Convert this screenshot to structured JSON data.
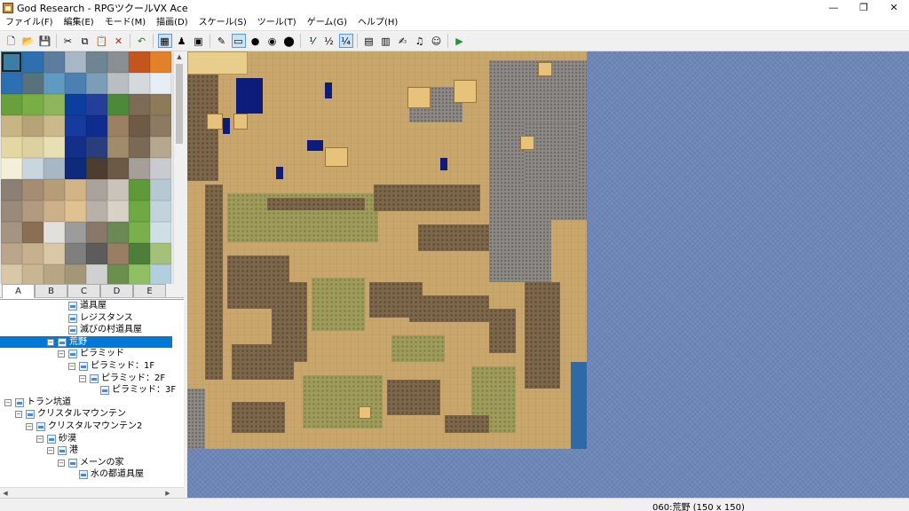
{
  "window": {
    "title": "God Research - RPGツクールVX Ace",
    "controls": {
      "minimize": "—",
      "restore": "❐",
      "close": "✕"
    }
  },
  "menu": [
    "ファイル(F)",
    "編集(E)",
    "モード(M)",
    "描画(D)",
    "スケール(S)",
    "ツール(T)",
    "ゲーム(G)",
    "ヘルプ(H)"
  ],
  "toolbar": {
    "icons": [
      "new-project-icon",
      "open-project-icon",
      "save-project-icon",
      "sep",
      "cut-icon",
      "copy-icon",
      "paste-icon",
      "delete-icon",
      "sep",
      "undo-icon",
      "sep",
      "map-mode-icon",
      "event-mode-icon",
      "region-mode-icon",
      "sep",
      "pencil-icon",
      "rectangle-icon",
      "ellipse-icon",
      "fill-icon",
      "shadow-pen-icon",
      "sep",
      "zoom-1-1-icon",
      "zoom-1-2-icon",
      "zoom-1-4-icon",
      "sep",
      "database-icon",
      "resource-manager-icon",
      "script-editor-icon",
      "sound-test-icon",
      "character-generator-icon",
      "sep",
      "playtest-icon"
    ],
    "glyphs": {
      "new-project-icon": "🗋",
      "open-project-icon": "📂",
      "save-project-icon": "💾",
      "cut-icon": "✂",
      "copy-icon": "⧉",
      "paste-icon": "📋",
      "delete-icon": "✕",
      "undo-icon": "↶",
      "map-mode-icon": "▦",
      "event-mode-icon": "♟",
      "region-mode-icon": "▣",
      "pencil-icon": "✎",
      "rectangle-icon": "▭",
      "ellipse-icon": "●",
      "fill-icon": "◉",
      "shadow-pen-icon": "⬤",
      "zoom-1-1-icon": "⅟",
      "zoom-1-2-icon": "½",
      "zoom-1-4-icon": "¼",
      "database-icon": "▤",
      "resource-manager-icon": "▥",
      "script-editor-icon": "✍",
      "sound-test-icon": "♫",
      "character-generator-icon": "☺",
      "playtest-icon": "▶"
    },
    "active": [
      "map-mode-icon",
      "rectangle-icon",
      "zoom-1-4-icon"
    ]
  },
  "tileset": {
    "tile_colors": [
      "#3b7fa6",
      "#2f6fb0",
      "#5c7d9e",
      "#a8b7c6",
      "#6f8593",
      "#8a8f93",
      "#c2561d",
      "#e3802a",
      "#2d70b2",
      "#58727d",
      "#5f9bc0",
      "#4c7fb2",
      "#7b9db5",
      "#b9bec0",
      "#d6d9db",
      "#e6eef3",
      "#6aa03c",
      "#79ad45",
      "#8fb55b",
      "#0c3ea0",
      "#233f9a",
      "#4c8a3a",
      "#7c6b55",
      "#8c7a58",
      "#c7b584",
      "#b7a37a",
      "#cbb98c",
      "#163a9e",
      "#0e2d8f",
      "#9c8062",
      "#6f5a46",
      "#8d7a63",
      "#e3d7a4",
      "#ddd29f",
      "#e9dfb5",
      "#132f8a",
      "#2b3e7c",
      "#a08b6a",
      "#7a6a55",
      "#b5a88e",
      "#f4efd9",
      "#c9d6df",
      "#a6b8c6",
      "#0d2a7d",
      "#4b3e2e",
      "#6a5a46",
      "#a59f9a",
      "#c8ccd0",
      "#8c7f74",
      "#a58d73",
      "#b79c78",
      "#d2b486",
      "#a9a39b",
      "#c9c3b9",
      "#5f9a3a",
      "#b6c8d3",
      "#9a8a7a",
      "#b29a80",
      "#cbb08a",
      "#e0c291",
      "#b8b1a7",
      "#d7d1c6",
      "#6ea943",
      "#c3d3dd",
      "#a49482",
      "#8a6f55",
      "#e2e0db",
      "#9c9c9c",
      "#87786a",
      "#6a8a55",
      "#7ab04c",
      "#cfdfe6",
      "#bba68b",
      "#c7b08e",
      "#d9c7a5",
      "#7f7f7f",
      "#5c5c5c",
      "#9a7e64",
      "#4e7f3a",
      "#a5c07a",
      "#d8c8a8",
      "#c9b592",
      "#b8a584",
      "#a49778",
      "#d0d0d0",
      "#6b8f4d",
      "#8fbf62",
      "#b2cfe0"
    ],
    "tabs": [
      "A",
      "B",
      "C",
      "D",
      "E"
    ],
    "active_tab": "A"
  },
  "map_tree": [
    {
      "label": "道具屋",
      "level": 5,
      "expander": ""
    },
    {
      "label": "レジスタンス",
      "level": 5,
      "expander": ""
    },
    {
      "label": "滅びの村道具屋",
      "level": 5,
      "expander": ""
    },
    {
      "label": "荒野",
      "level": 4,
      "expander": "−",
      "selected": true
    },
    {
      "label": "ピラミッド",
      "level": 5,
      "expander": "−"
    },
    {
      "label": "ピラミッド：1F",
      "level": 6,
      "expander": "−"
    },
    {
      "label": "ピラミッド：2F",
      "level": 7,
      "expander": "−"
    },
    {
      "label": "ピラミッド：3F",
      "level": 8,
      "expander": ""
    },
    {
      "label": "トラン坑道",
      "level": 0,
      "expander": "−"
    },
    {
      "label": "クリスタルマウンテン",
      "level": 1,
      "expander": "−"
    },
    {
      "label": "クリスタルマウンテン2",
      "level": 2,
      "expander": "−"
    },
    {
      "label": "砂漠",
      "level": 3,
      "expander": "−"
    },
    {
      "label": "港",
      "level": 4,
      "expander": "−"
    },
    {
      "label": "メーンの家",
      "level": 5,
      "expander": "−"
    },
    {
      "label": "水の都道具屋",
      "level": 6,
      "expander": ""
    }
  ],
  "status": {
    "map_info": "060:荒野 (150 x 150)"
  }
}
